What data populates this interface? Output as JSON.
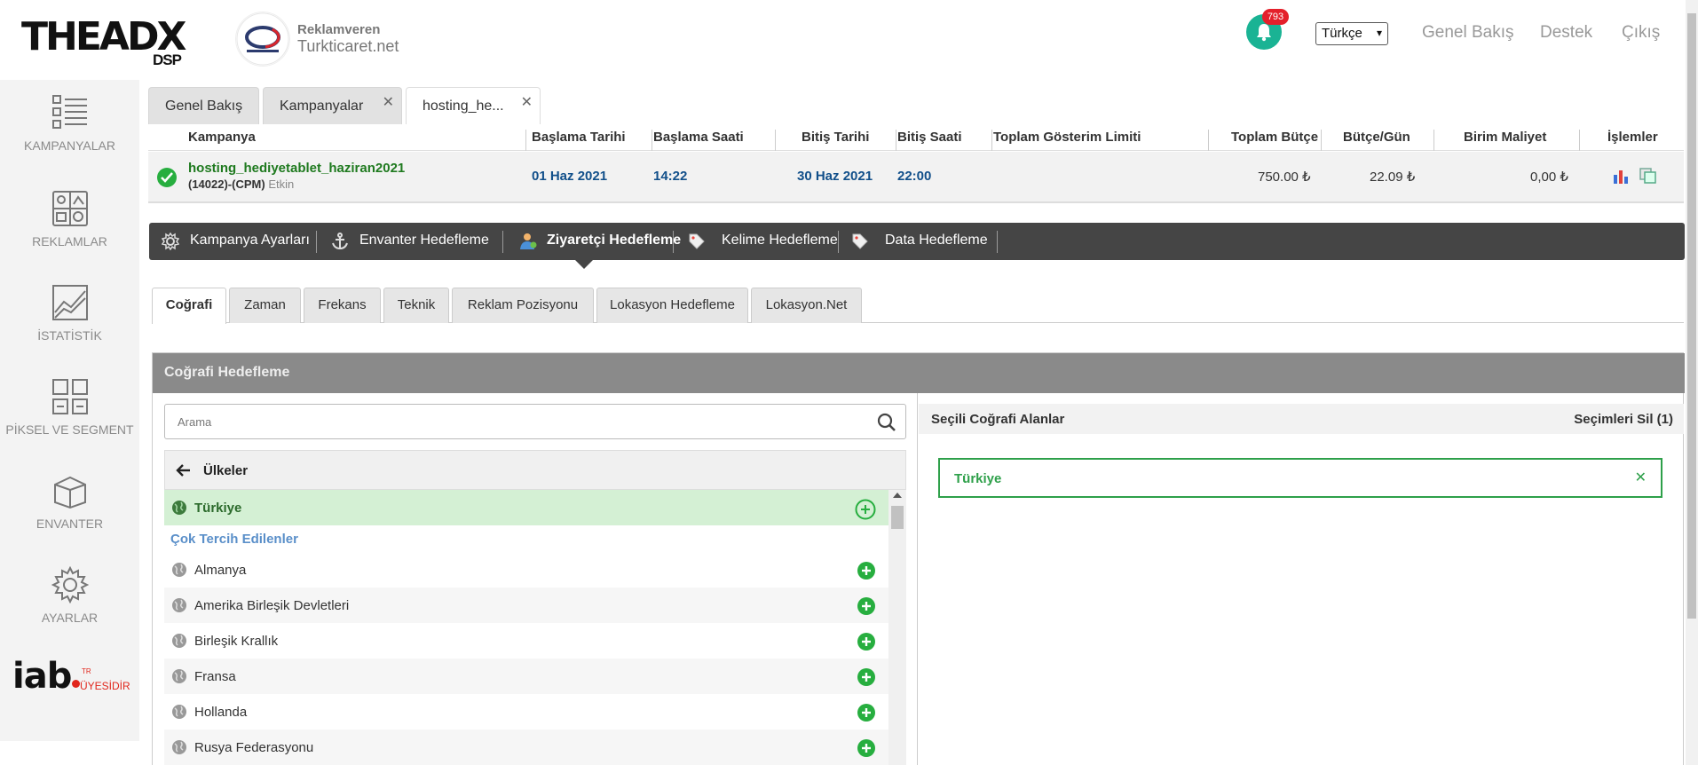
{
  "header": {
    "logo_main": "THEADX",
    "logo_sub": "DSP",
    "advertiser_label": "Reklamveren",
    "advertiser_name": "Turkticaret.net",
    "notification_count": "793",
    "language": "Türkçe",
    "links": [
      "Genel Bakış",
      "Destek",
      "Çıkış"
    ]
  },
  "sidebar": {
    "items": [
      {
        "label": "KAMPANYALAR",
        "icon": "list-icon"
      },
      {
        "label": "REKLAMLAR",
        "icon": "ads-icon"
      },
      {
        "label": "İSTATİSTİK",
        "icon": "chart-icon"
      },
      {
        "label": "PİKSEL VE SEGMENT",
        "icon": "segment-icon"
      },
      {
        "label": "ENVANTER",
        "icon": "box-icon"
      },
      {
        "label": "AYARLAR",
        "icon": "gear-icon"
      }
    ],
    "iab_main": "iab",
    "iab_tr": "TR",
    "iab_uye": "ÜYESİDİR"
  },
  "top_tabs": [
    {
      "label": "Genel Bakış"
    },
    {
      "label": "Kampanyalar"
    },
    {
      "label": "hosting_he..."
    }
  ],
  "campaign_table": {
    "headers": [
      "Kampanya",
      "Başlama Tarihi",
      "Başlama Saati",
      "Bitiş Tarihi",
      "Bitiş Saati",
      "Toplam Gösterim Limiti",
      "Toplam Bütçe",
      "Bütçe/Gün",
      "Birim Maliyet",
      "İşlemler"
    ],
    "row": {
      "name": "hosting_hediyetablet_haziran2021",
      "meta": "(14022)-(CPM)",
      "status": "Etkin",
      "start_date": "01 Haz 2021",
      "start_time": "14:22",
      "end_date": "30 Haz 2021",
      "end_time": "22:00",
      "impression_limit": "",
      "total_budget": "750.00 ₺",
      "daily_budget": "22.09 ₺",
      "unit_cost": "0,00 ₺"
    }
  },
  "subnav": {
    "items": [
      "Kampanya Ayarları",
      "Envanter Hedefleme",
      "Ziyaretçi Hedefleme",
      "Kelime Hedefleme",
      "Data Hedefleme"
    ],
    "active": "Ziyaretçi Hedefleme"
  },
  "targeting_tabs": [
    "Coğrafi",
    "Zaman",
    "Frekans",
    "Teknik",
    "Reklam Pozisyonu",
    "Lokasyon Hedefleme",
    "Lokasyon.Net"
  ],
  "geo": {
    "title": "Coğrafi Hedefleme",
    "search_placeholder": "Arama",
    "list_title": "Ülkeler",
    "selected_country": "Türkiye",
    "group_label": "Çok Tercih Edilenler",
    "countries": [
      "Almanya",
      "Amerika Birleşik Devletleri",
      "Birleşik Krallık",
      "Fransa",
      "Hollanda",
      "Rusya Federasyonu"
    ],
    "selected_title": "Seçili Coğrafi Alanlar",
    "clear_label": "Seçimleri Sil (1)",
    "selected_items": [
      "Türkiye"
    ]
  },
  "colors": {
    "accent_green": "#27ae3f",
    "notif_teal": "#1ab394",
    "badge_red": "#e4202b",
    "link_blue": "#114f8a",
    "subnav_dark": "#454545"
  }
}
